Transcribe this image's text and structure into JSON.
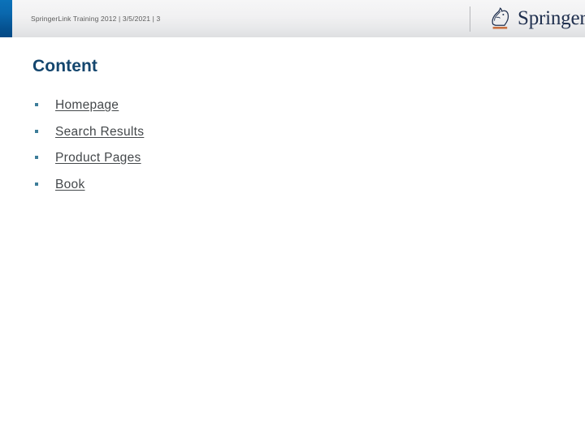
{
  "slide": {
    "header": {
      "meta_text": "SpringerLink Training 2012 | 3/5/2021 | 3",
      "accent_color": "#0a68ae",
      "band_background": "#eeeff0"
    },
    "brand": {
      "wordmark": "Springer",
      "mark_icon": "springer-knight-icon",
      "mark_color": "#20304f",
      "mark_underline_color": "#c9703f",
      "divider_icon": "vertical-divider"
    },
    "title": "Content",
    "title_color": "#14466e",
    "list": {
      "bullet_icon": "square-bullet-icon",
      "bullet_color": "#3d7d99",
      "link_color": "#44484b",
      "items": [
        {
          "label": "Homepage"
        },
        {
          "label": "Search Results"
        },
        {
          "label": "Product Pages"
        },
        {
          "label": "Book"
        }
      ]
    }
  }
}
